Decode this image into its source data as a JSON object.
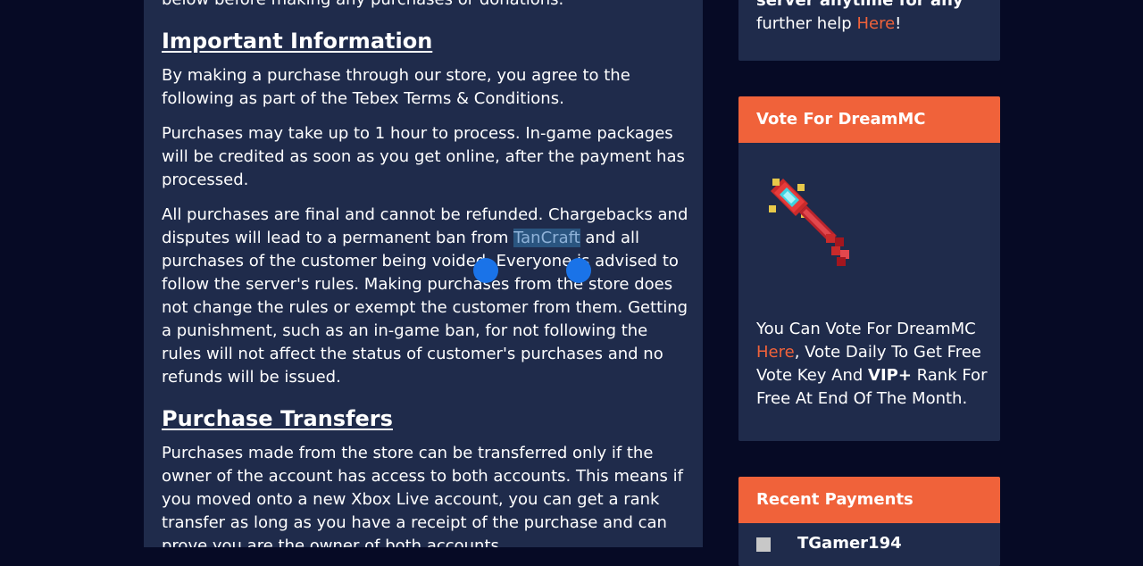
{
  "main": {
    "intro_tail": "below before making any purchases or donations.",
    "section1": {
      "heading": "Important Information",
      "p1": "By making a purchase through our store, you agree to the following as part of the Tebex Terms & Conditions.",
      "p2": "Purchases may take up to 1 hour to process. In-game packages will be credited as soon as you get online, after the payment has processed.",
      "p3_before": "All purchases are final and cannot be refunded.  Chargebacks and disputes will lead to a permanent ban from ",
      "p3_selected": "TanCraft",
      "p3_after": " and all purchases of the customer being voided. Everyone is advised to follow the server's rules. Making purchases from the store does not change the rules or exempt the customer from them. Getting a punishment, such as an in-game ban, for not following the rules will not affect the status of customer's purchases and no refunds will be issued."
    },
    "section2": {
      "heading": "Purchase Transfers",
      "p1": "Purchases made from the store can be transferred only if the owner of the account has access to both accounts. This means if you moved onto a new Xbox Live account, you can get a rank transfer as long as you have a receipt of the purchase and can prove you are the owner of both accounts."
    }
  },
  "sidebar": {
    "help_card": {
      "line1": "server anytime for any",
      "line2_before": "further help ",
      "line2_link": "Here",
      "line2_after": "!"
    },
    "vote_card": {
      "title": "Vote For DreamMC",
      "text_before": "You Can Vote For DreamMC ",
      "link": "Here",
      "text_middle": ", Vote Daily To Get Free Vote Key And ",
      "bold": "VIP+",
      "text_after": " Rank For Free At End Of The Month.",
      "icon": "vote-key-icon"
    },
    "payments_card": {
      "title": "Recent Payments",
      "first_user": "TGamer194"
    }
  },
  "colors": {
    "page_bg": "#060a25",
    "panel_bg": "#1f2b4b",
    "accent": "#f0623a",
    "selection": "#2a5580",
    "handle": "#1a73e8"
  }
}
